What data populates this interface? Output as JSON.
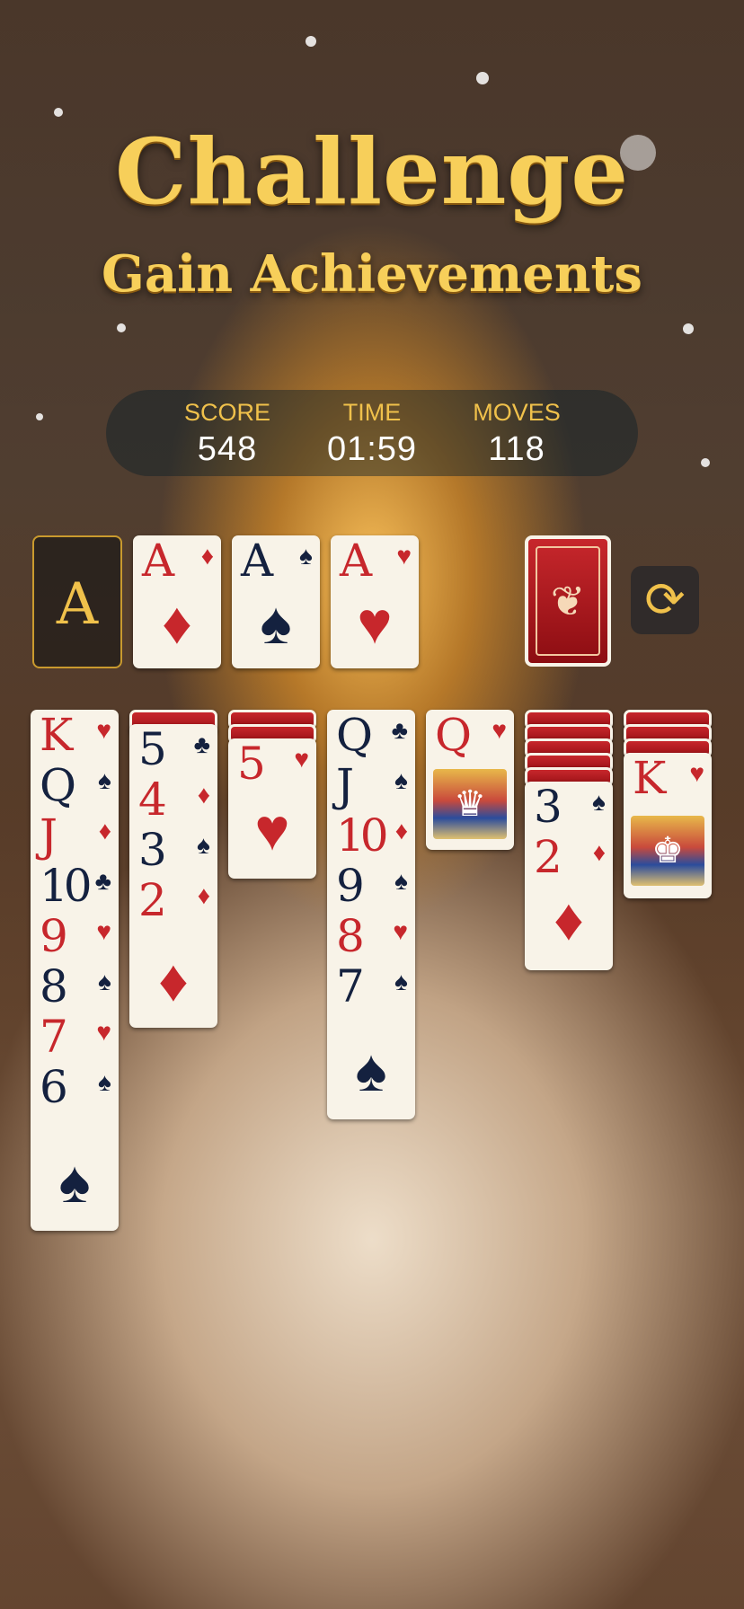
{
  "titles": {
    "main": "Challenge",
    "sub": "Gain Achievements"
  },
  "hud": {
    "score_label": "SCORE",
    "score_value": "548",
    "time_label": "TIME",
    "time_value": "01:59",
    "moves_label": "MOVES",
    "moves_value": "118"
  },
  "foundation": [
    {
      "rank": "A",
      "suit": "♦",
      "color": "red"
    },
    {
      "rank": "A",
      "suit": "♠",
      "color": "black"
    },
    {
      "rank": "A",
      "suit": "♥",
      "color": "red"
    }
  ],
  "ace_slot_label": "A",
  "stock_icon": "deck-back-ornament",
  "recycle_icon": "refresh-icon",
  "tableau": {
    "col1": [
      {
        "rank": "K",
        "suit": "♥",
        "color": "red"
      },
      {
        "rank": "Q",
        "suit": "♠",
        "color": "black"
      },
      {
        "rank": "J",
        "suit": "♦",
        "color": "red"
      },
      {
        "rank": "10",
        "suit": "♣",
        "color": "black"
      },
      {
        "rank": "9",
        "suit": "♥",
        "color": "red"
      },
      {
        "rank": "8",
        "suit": "♠",
        "color": "black"
      },
      {
        "rank": "7",
        "suit": "♥",
        "color": "red"
      },
      {
        "rank": "6",
        "suit": "♠",
        "color": "black"
      }
    ],
    "col2": [
      {
        "rank": "5",
        "suit": "♣",
        "color": "black"
      },
      {
        "rank": "4",
        "suit": "♦",
        "color": "red"
      },
      {
        "rank": "3",
        "suit": "♠",
        "color": "black"
      },
      {
        "rank": "2",
        "suit": "♦",
        "color": "red"
      }
    ],
    "col3": [
      {
        "rank": "5",
        "suit": "♥",
        "color": "red"
      }
    ],
    "col4": [
      {
        "rank": "Q",
        "suit": "♣",
        "color": "black"
      },
      {
        "rank": "J",
        "suit": "♠",
        "color": "black"
      },
      {
        "rank": "10",
        "suit": "♦",
        "color": "red"
      },
      {
        "rank": "9",
        "suit": "♠",
        "color": "black"
      },
      {
        "rank": "8",
        "suit": "♥",
        "color": "red"
      },
      {
        "rank": "7",
        "suit": "♠",
        "color": "black"
      }
    ],
    "col5": [
      {
        "rank": "Q",
        "suit": "♥",
        "color": "red",
        "face": "queen"
      }
    ],
    "col6": [
      {
        "rank": "3",
        "suit": "♠",
        "color": "black"
      },
      {
        "rank": "2",
        "suit": "♦",
        "color": "red"
      }
    ],
    "col7": [
      {
        "rank": "K",
        "suit": "♥",
        "color": "red",
        "face": "king"
      }
    ]
  },
  "colors": {
    "gold": "#f0c14b",
    "card_red": "#c7272c",
    "card_black": "#14213f",
    "card_face": "#f8f3e8"
  }
}
